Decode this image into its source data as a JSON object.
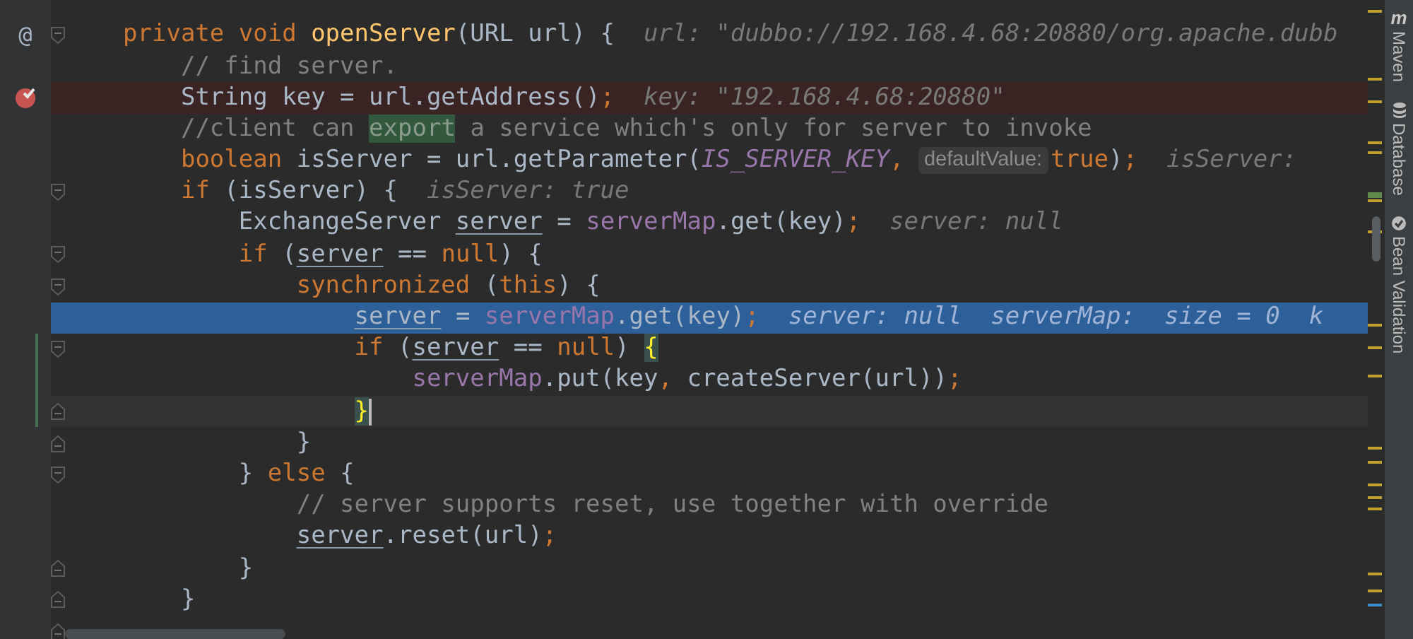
{
  "editor": {
    "lines": [
      {
        "kind": "normal",
        "gutter_mark": "@",
        "fold_start": true,
        "tokens": [
          {
            "kind": "keyword",
            "text": "private void "
          },
          {
            "kind": "method",
            "text": "openServer"
          },
          {
            "kind": "plain",
            "text": "(URL url) {"
          },
          {
            "kind": "hint",
            "text": "url: \"dubbo://192.168.4.68:20880/org.apache.dubb"
          }
        ]
      },
      {
        "kind": "normal",
        "tokens": [
          {
            "kind": "comment",
            "text": "    // find server."
          }
        ]
      },
      {
        "kind": "breakpoint",
        "tokens": [
          {
            "kind": "plain",
            "text": "    String key = url.getAddress()"
          },
          {
            "kind": "punct",
            "text": ";"
          },
          {
            "kind": "hint",
            "text": "key: \"192.168.4.68:20880\""
          }
        ]
      },
      {
        "kind": "normal",
        "tokens": [
          {
            "kind": "comment",
            "text": "    //client can "
          },
          {
            "kind": "match",
            "text": "export"
          },
          {
            "kind": "comment",
            "text": " a service which's only for server to invoke"
          }
        ]
      },
      {
        "kind": "normal",
        "tokens": [
          {
            "kind": "keyword",
            "text": "    boolean "
          },
          {
            "kind": "plain",
            "text": "isServer = url.getParameter("
          },
          {
            "kind": "constant",
            "text": "IS_SERVER_KEY"
          },
          {
            "kind": "punct",
            "text": ", "
          },
          {
            "kind": "param",
            "text": "defaultValue:"
          },
          {
            "kind": "keyword",
            "text": "true"
          },
          {
            "kind": "plain",
            "text": ")"
          },
          {
            "kind": "punct",
            "text": ";"
          },
          {
            "kind": "hint",
            "text": "isServer:"
          }
        ]
      },
      {
        "kind": "normal",
        "fold_start": true,
        "tokens": [
          {
            "kind": "keyword",
            "text": "    if "
          },
          {
            "kind": "plain",
            "text": "(isServer) {"
          },
          {
            "kind": "hint",
            "text": "isServer: true"
          }
        ]
      },
      {
        "kind": "normal",
        "tokens": [
          {
            "kind": "plain",
            "text": "        ExchangeServer "
          },
          {
            "kind": "variable",
            "text": "server"
          },
          {
            "kind": "plain",
            "text": " = "
          },
          {
            "kind": "field",
            "text": "serverMap"
          },
          {
            "kind": "plain",
            "text": ".get(key)"
          },
          {
            "kind": "punct",
            "text": ";"
          },
          {
            "kind": "hint",
            "text": "server: null"
          }
        ]
      },
      {
        "kind": "normal",
        "fold_start": true,
        "tokens": [
          {
            "kind": "keyword",
            "text": "        if "
          },
          {
            "kind": "plain",
            "text": "("
          },
          {
            "kind": "variable",
            "text": "server"
          },
          {
            "kind": "plain",
            "text": " == "
          },
          {
            "kind": "keyword",
            "text": "null"
          },
          {
            "kind": "plain",
            "text": ") {"
          }
        ]
      },
      {
        "kind": "normal",
        "fold_start": true,
        "tokens": [
          {
            "kind": "keyword",
            "text": "            synchronized "
          },
          {
            "kind": "plain",
            "text": "("
          },
          {
            "kind": "keyword",
            "text": "this"
          },
          {
            "kind": "plain",
            "text": ") {"
          }
        ]
      },
      {
        "kind": "execution",
        "tokens": [
          {
            "kind": "variable",
            "text": "                server"
          },
          {
            "kind": "plain",
            "text": " = "
          },
          {
            "kind": "field",
            "text": "serverMap"
          },
          {
            "kind": "plain",
            "text": ".get(key)"
          },
          {
            "kind": "punct",
            "text": ";"
          },
          {
            "kind": "hint",
            "text": "server: null  serverMap:  size = 0  k"
          }
        ]
      },
      {
        "kind": "normal",
        "fold_start": true,
        "changed": true,
        "tokens": [
          {
            "kind": "keyword",
            "text": "                if "
          },
          {
            "kind": "plain",
            "text": "("
          },
          {
            "kind": "variable",
            "text": "server"
          },
          {
            "kind": "plain",
            "text": " == "
          },
          {
            "kind": "keyword",
            "text": "null"
          },
          {
            "kind": "plain",
            "text": ") "
          },
          {
            "kind": "brace",
            "text": "{"
          }
        ]
      },
      {
        "kind": "normal",
        "changed": true,
        "tokens": [
          {
            "kind": "field",
            "text": "                    serverMap"
          },
          {
            "kind": "plain",
            "text": ".put(key"
          },
          {
            "kind": "punct",
            "text": ", "
          },
          {
            "kind": "plain",
            "text": "createServer(url))"
          },
          {
            "kind": "punct",
            "text": ";"
          }
        ]
      },
      {
        "kind": "caret",
        "fold_end": true,
        "changed": true,
        "tokens": [
          {
            "kind": "brace",
            "text": "                }"
          }
        ]
      },
      {
        "kind": "normal",
        "fold_end": true,
        "tokens": [
          {
            "kind": "plain",
            "text": "            }"
          }
        ]
      },
      {
        "kind": "normal",
        "fold_start": true,
        "tokens": [
          {
            "kind": "plain",
            "text": "        } "
          },
          {
            "kind": "keyword",
            "text": "else"
          },
          {
            "kind": "plain",
            "text": " {"
          }
        ]
      },
      {
        "kind": "normal",
        "tokens": [
          {
            "kind": "comment",
            "text": "            // server supports reset, use together with override"
          }
        ]
      },
      {
        "kind": "normal",
        "tokens": [
          {
            "kind": "variable",
            "text": "            server"
          },
          {
            "kind": "plain",
            "text": ".reset(url)"
          },
          {
            "kind": "punct",
            "text": ";"
          }
        ]
      },
      {
        "kind": "normal",
        "fold_end": true,
        "tokens": [
          {
            "kind": "plain",
            "text": "        }"
          }
        ]
      },
      {
        "kind": "normal",
        "fold_end": true,
        "tokens": [
          {
            "kind": "plain",
            "text": "    }"
          }
        ]
      },
      {
        "kind": "normal",
        "fold_end": true
      }
    ]
  },
  "tool_windows": [
    {
      "kind": "maven",
      "glyph": "m",
      "label": "Maven"
    },
    {
      "kind": "database",
      "label": "Database"
    },
    {
      "kind": "bean",
      "label": "Bean Validation"
    }
  ]
}
